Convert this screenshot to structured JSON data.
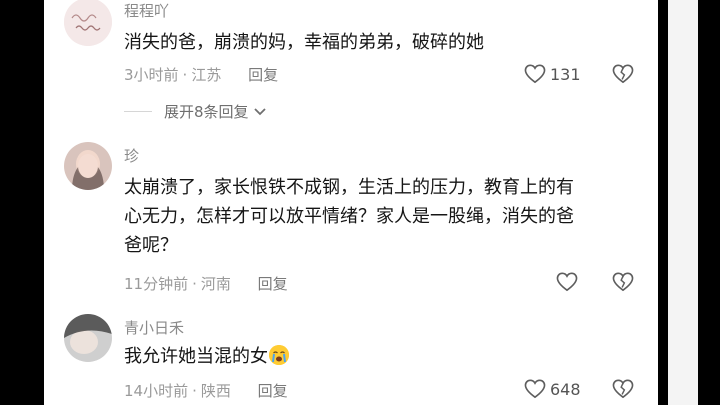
{
  "comments": [
    {
      "username": "程程吖",
      "text": "消失的爸，崩溃的妈，幸福的弟弟，破碎的她",
      "time": "3小时前",
      "location": "江苏",
      "reply_label": "回复",
      "likes": "131",
      "expand_label": "展开8条回复"
    },
    {
      "username": "珍",
      "text_line1": "太崩溃了，家长恨铁不成钢，生活上的压力，教育上的有",
      "text_line2": "心无力，怎样才可以放平情绪？家人是一股绳，消失的爸",
      "text_line3": "爸呢？",
      "time": "11分钟前",
      "location": "河南",
      "reply_label": "回复"
    },
    {
      "username": "青小日禾",
      "text": "我允许她当混的女",
      "time": "14小时前",
      "location": "陕西",
      "reply_label": "回复",
      "likes": "648"
    }
  ],
  "icons": {
    "like": "heart-outline-icon",
    "dislike": "broken-heart-outline-icon",
    "expand": "chevron-down-icon",
    "emoji": "crying-face-emoji"
  },
  "colors": {
    "text": "#161616",
    "meta": "#9a9a9a",
    "username": "#8a8a8a",
    "background": "#ffffff"
  }
}
